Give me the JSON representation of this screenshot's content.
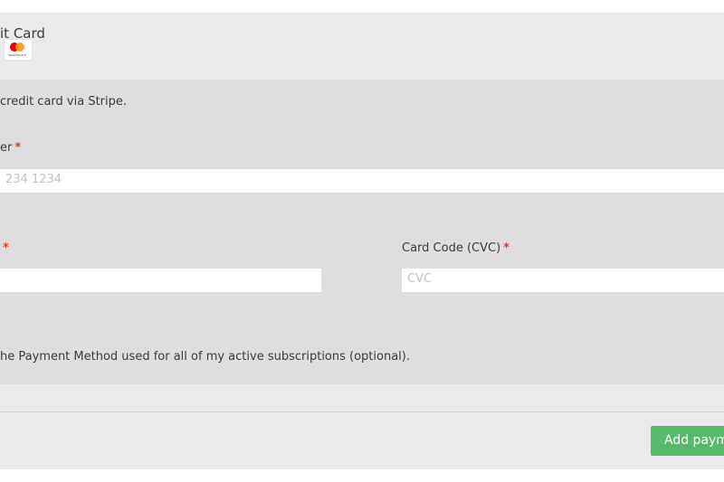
{
  "payment_method": {
    "title": "it Card",
    "logo_text": "mastercard",
    "description": "credit card via Stripe."
  },
  "card_number": {
    "label": "er",
    "required": "*",
    "placeholder": "234 1234"
  },
  "expiry": {
    "label": "",
    "required": "*",
    "placeholder": ""
  },
  "cvc": {
    "label": "Card Code (CVC)",
    "required": "*",
    "placeholder": "CVC"
  },
  "save_method": {
    "label": "he Payment Method used for all of my active subscriptions (optional)."
  },
  "submit": {
    "label": "Add paym"
  },
  "colors": {
    "top_panel": "#ebe9eb",
    "main_panel": "#dfdddf",
    "required": "#e2401c",
    "button": "#57b96b"
  },
  "icons": {
    "card_logo": "mastercard-icon"
  }
}
